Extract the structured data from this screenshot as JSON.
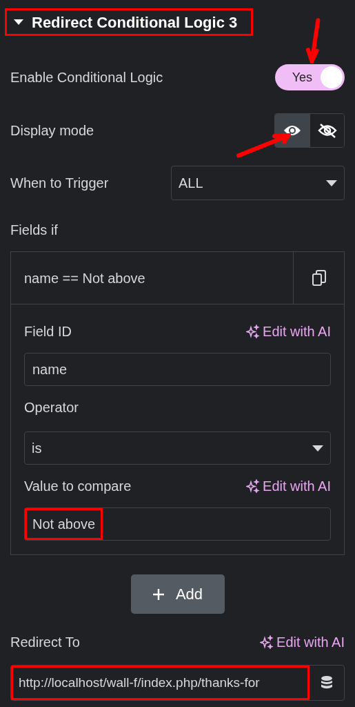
{
  "section": {
    "title": "Redirect Conditional Logic 3",
    "expanded": true,
    "highlighted": true
  },
  "enable_logic": {
    "label": "Enable Conditional Logic",
    "on": true,
    "text": "Yes"
  },
  "display_mode": {
    "label": "Display mode",
    "options": [
      {
        "kind": "show",
        "selected": true
      },
      {
        "kind": "hide",
        "selected": false
      }
    ]
  },
  "trigger": {
    "label": "When to Trigger",
    "value": "ALL"
  },
  "fields_if": {
    "label": "Fields if",
    "item": {
      "title": "name == Not above",
      "expanded": true,
      "controls": [
        {
          "kind": "text",
          "label": "Field ID",
          "ai": "Edit with AI",
          "value": "name"
        },
        {
          "kind": "select",
          "label": "Operator",
          "value": "is"
        },
        {
          "kind": "text",
          "label": "Value to compare",
          "ai": "Edit with AI",
          "value": "Not above",
          "highlighted": true
        }
      ]
    },
    "add_button": "Add"
  },
  "redirect": {
    "label": "Redirect To",
    "ai": "Edit with AI",
    "value": "http://localhost/wall-f/index.php/thanks-for",
    "highlighted": true
  }
}
